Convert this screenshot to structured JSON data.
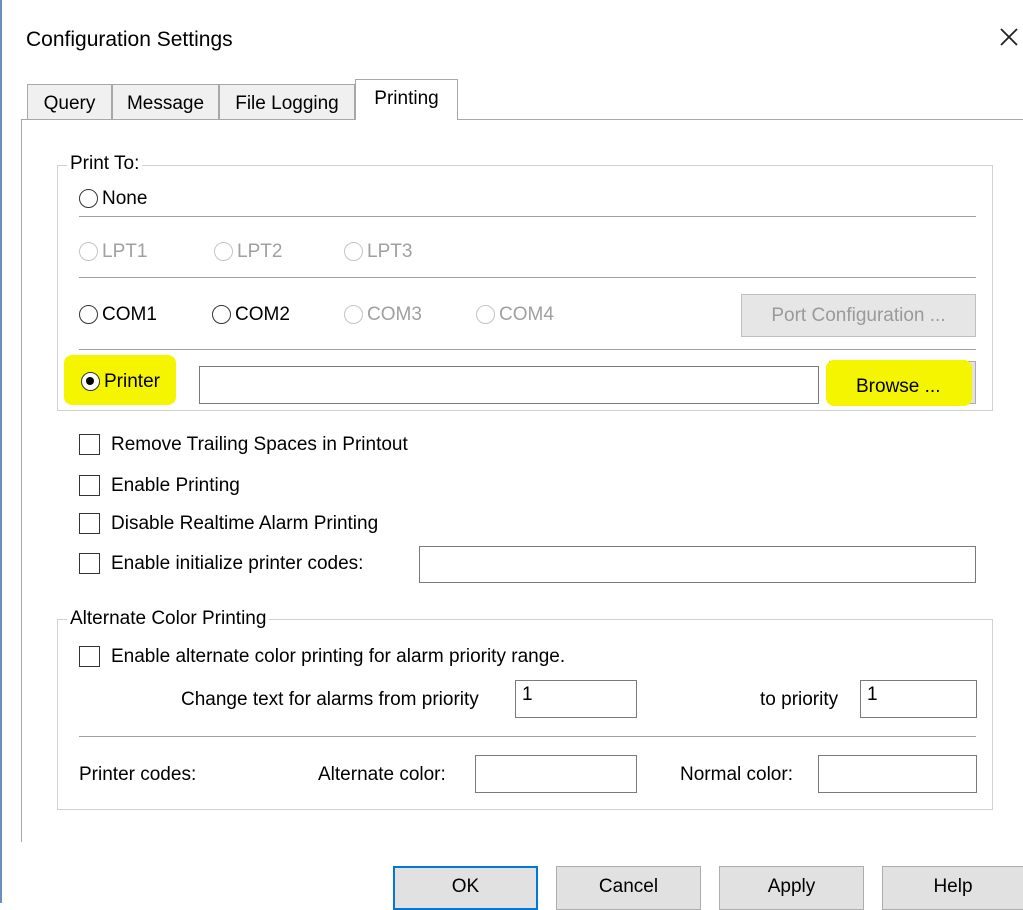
{
  "window": {
    "title": "Configuration Settings",
    "close_icon": "close-icon"
  },
  "tabs": [
    {
      "label": "Query",
      "active": false
    },
    {
      "label": "Message",
      "active": false
    },
    {
      "label": "File Logging",
      "active": false
    },
    {
      "label": "Printing",
      "active": true
    }
  ],
  "print_to": {
    "label": "Print To:",
    "none_label": "None",
    "lpt": [
      "LPT1",
      "LPT2",
      "LPT3"
    ],
    "com": [
      "COM1",
      "COM2",
      "COM3",
      "COM4"
    ],
    "port_config_label": "Port Configuration ...",
    "printer_label": "Printer",
    "printer_selected": true,
    "printer_value": "",
    "browse_label": "Browse ..."
  },
  "options": {
    "remove_trailing": "Remove Trailing Spaces in Printout",
    "enable_printing": "Enable Printing",
    "disable_realtime": "Disable Realtime Alarm Printing",
    "init_codes": "Enable initialize printer codes:",
    "init_codes_value": ""
  },
  "alternate": {
    "label": "Alternate Color Printing",
    "enable_label": "Enable alternate color printing for alarm priority range.",
    "from_label": "Change text for alarms from priority",
    "from_value": "1",
    "to_label": "to priority",
    "to_value": "1",
    "printer_codes_label": "Printer codes:",
    "alt_color_label": "Alternate color:",
    "alt_color_value": "",
    "normal_color_label": "Normal color:",
    "normal_color_value": ""
  },
  "buttons": {
    "ok": "OK",
    "cancel": "Cancel",
    "apply": "Apply",
    "help": "Help"
  },
  "colors": {
    "highlight": "#f5f500",
    "focus": "#0078d7"
  }
}
